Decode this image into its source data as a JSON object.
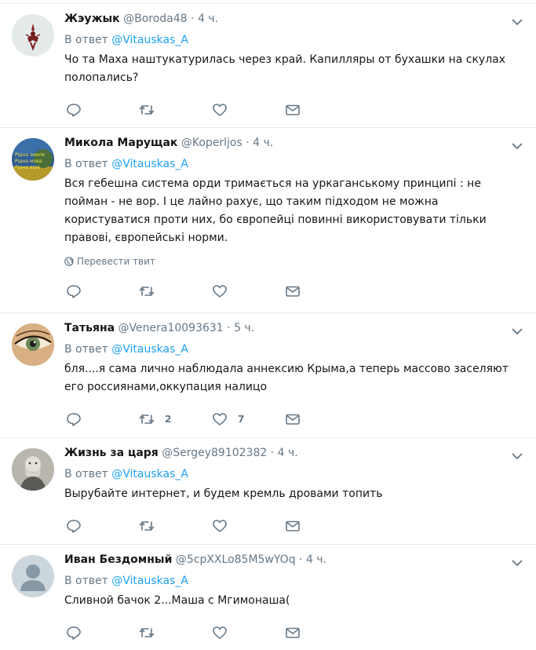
{
  "reply_prefix": "В ответ",
  "translate_label": "Перевести твит",
  "tweets": [
    {
      "name": "Жэужык",
      "handle": "@Boroda48",
      "time": "4 ч.",
      "reply_to": "@Vitauskas_A",
      "text": "Чо та Маха наштукатурилась через край. Капилляры от бухашки на скулах полопались?",
      "retweets": "",
      "likes": ""
    },
    {
      "name": "Микола Марущак",
      "handle": "@Koperljos",
      "time": "4 ч.",
      "reply_to": "@Vitauskas_A",
      "text": "Вся гебешна система орди тримається на уркаганському принципі : не пойман - не вор. І це лайно рахує, що таким підходом не можна користуватися проти них, бо європейці повинні використовувати тільки правові, європейські норми.",
      "avatar_text": [
        "Рідна земля",
        "Рідна мова",
        "Рідна віра"
      ],
      "retweets": "",
      "likes": ""
    },
    {
      "name": "Татьяна",
      "handle": "@Venera10093631",
      "time": "5 ч.",
      "reply_to": "@Vitauskas_A",
      "text": "бля....я сама лично наблюдала аннексию Крыма,а теперь массово заселяют его россиянами,оккупация налицо",
      "retweets": "2",
      "likes": "7"
    },
    {
      "name": "Жизнь за царя",
      "handle": "@Sergey89102382",
      "time": "4 ч.",
      "reply_to": "@Vitauskas_A",
      "text": "Вырубайте интернет, и будем кремль дровами топить",
      "retweets": "",
      "likes": ""
    },
    {
      "name": "Иван Бездомный",
      "handle": "@5cpXXLo85M5wYOq",
      "time": "4 ч.",
      "reply_to": "@Vitauskas_A",
      "text": "Сливной бачок 2...Маша с Мгимонаша(",
      "retweets": "",
      "likes": ""
    }
  ]
}
